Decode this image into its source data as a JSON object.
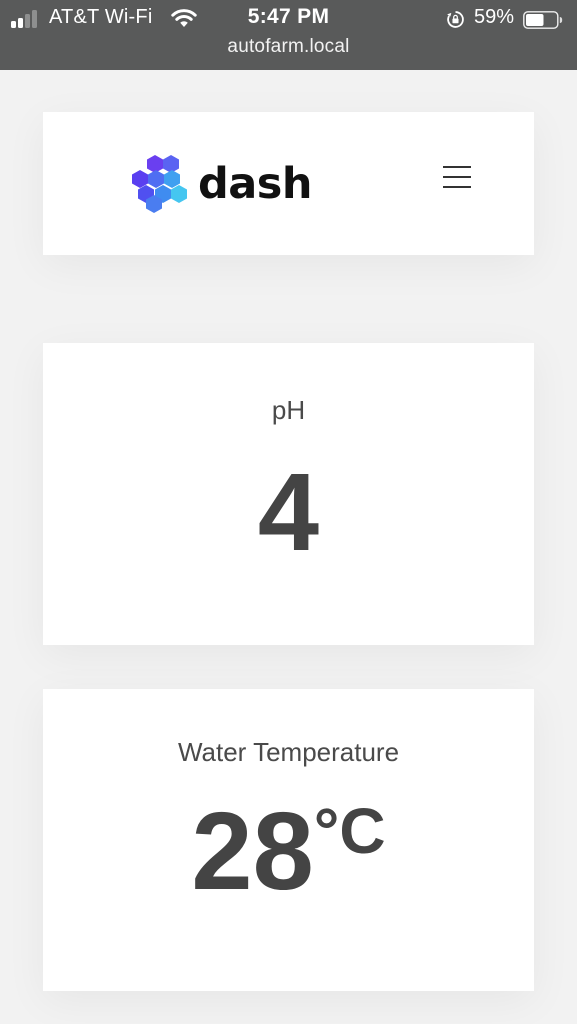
{
  "status_bar": {
    "carrier": "AT&T Wi-Fi",
    "time": "5:47 PM",
    "battery_percent": "59%",
    "battery_level": 0.59,
    "signal_bars_filled": 2,
    "signal_bars_total": 4,
    "url": "autofarm.local",
    "icons": [
      "signal-icon",
      "wifi-icon",
      "orientation-lock-icon",
      "battery-icon"
    ]
  },
  "header": {
    "logo_text": "dash",
    "logo_colors": [
      "#6a3ff0",
      "#4f6ef2",
      "#3fa0f0",
      "#45c6f0"
    ],
    "menu_icon": "hamburger-menu-icon"
  },
  "metrics": {
    "ph": {
      "label": "pH",
      "value": "4"
    },
    "water_temperature": {
      "label": "Water Temperature",
      "value": "28",
      "unit": "°C"
    }
  }
}
